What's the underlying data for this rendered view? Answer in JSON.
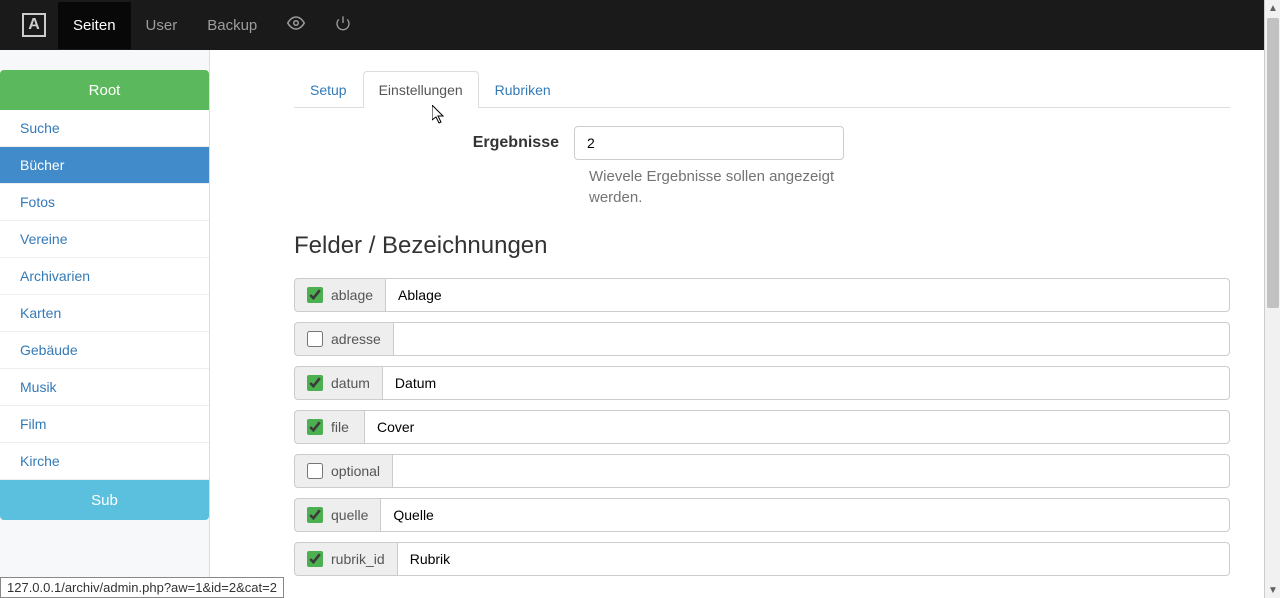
{
  "navbar": {
    "logo_letter": "A",
    "items": [
      "Seiten",
      "User",
      "Backup"
    ],
    "active_index": 0,
    "icons": [
      "eye-icon",
      "power-icon"
    ]
  },
  "sidebar": {
    "root_label": "Root",
    "items": [
      "Suche",
      "Bücher",
      "Fotos",
      "Vereine",
      "Archivarien",
      "Karten",
      "Gebäude",
      "Musik",
      "Film",
      "Kirche"
    ],
    "active_index": 1,
    "sub_label": "Sub"
  },
  "tabs": {
    "items": [
      "Setup",
      "Einstellungen",
      "Rubriken"
    ],
    "active_index": 1
  },
  "results": {
    "label": "Ergebnisse",
    "value": "2",
    "help": "Wievele Ergebnisse sollen angezeigt werden."
  },
  "section_title": "Felder / Bezeichnungen",
  "fields": [
    {
      "key": "ablage",
      "checked": true,
      "value": "Ablage"
    },
    {
      "key": "adresse",
      "checked": false,
      "value": ""
    },
    {
      "key": "datum",
      "checked": true,
      "value": "Datum"
    },
    {
      "key": "file",
      "checked": true,
      "value": "Cover"
    },
    {
      "key": "optional",
      "checked": false,
      "value": ""
    },
    {
      "key": "quelle",
      "checked": true,
      "value": "Quelle"
    },
    {
      "key": "rubrik_id",
      "checked": true,
      "value": "Rubrik"
    }
  ],
  "statusbar": "127.0.0.1/archiv/admin.php?aw=1&id=2&cat=2"
}
